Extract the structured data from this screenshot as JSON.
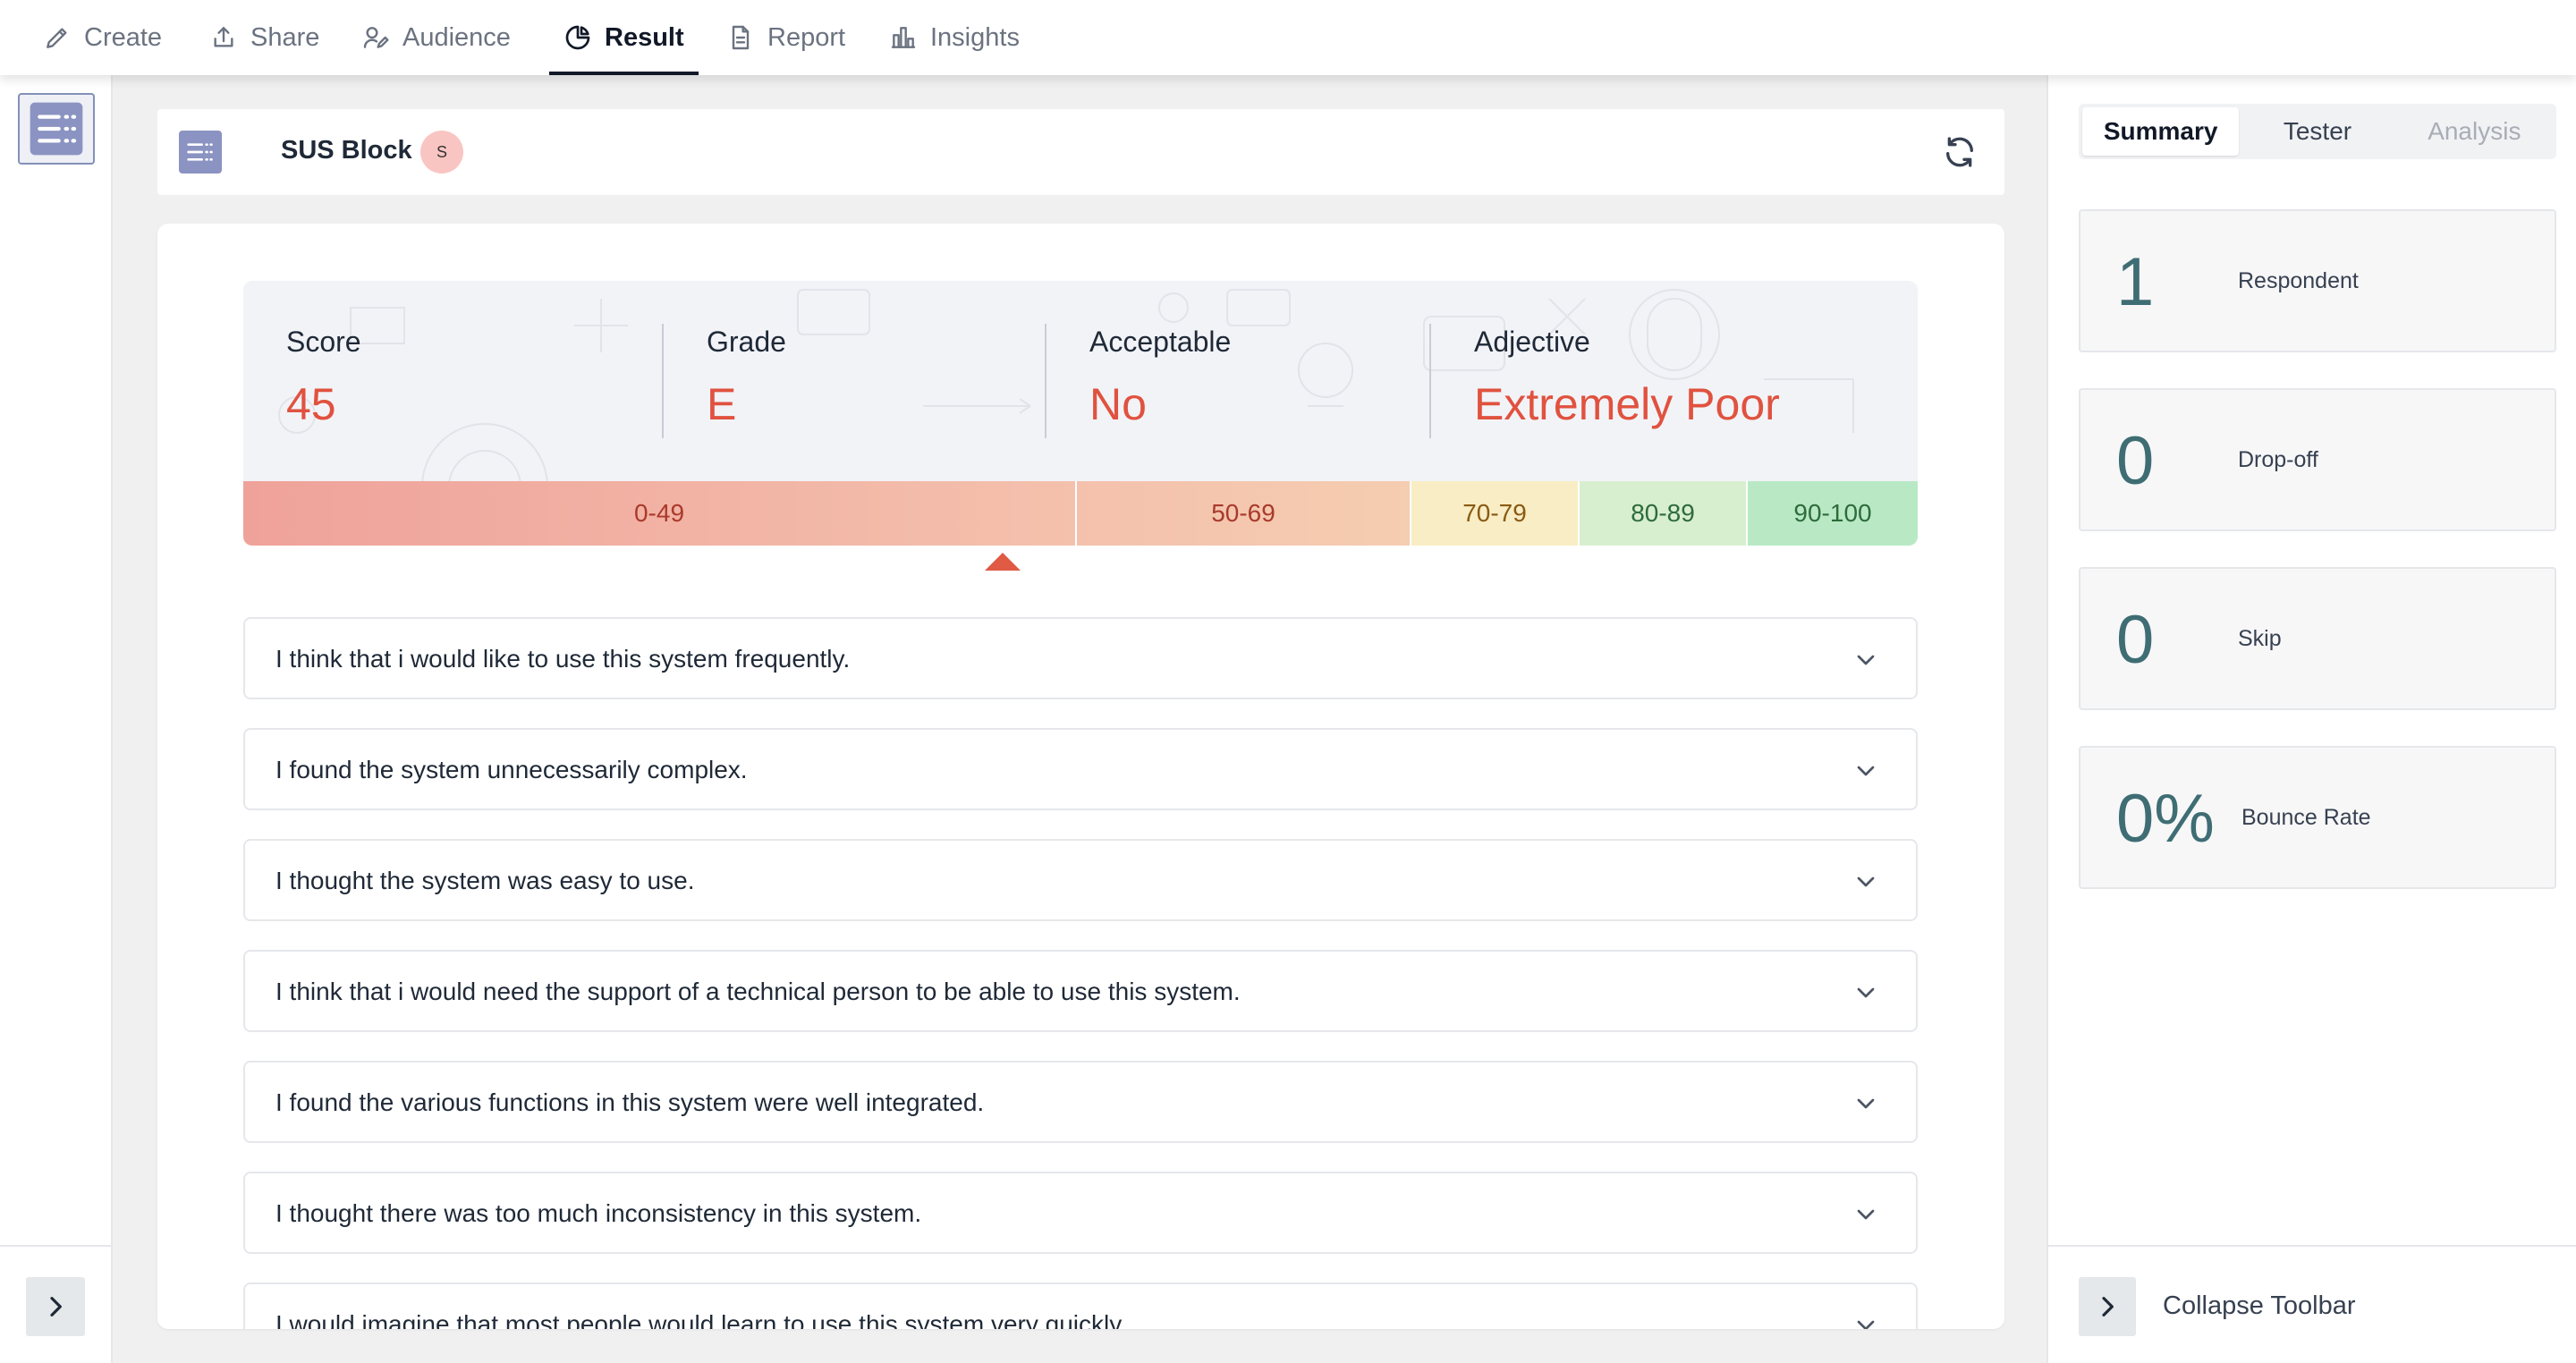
{
  "nav": {
    "items": [
      {
        "label": "Create",
        "icon": "pencil-icon"
      },
      {
        "label": "Share",
        "icon": "share-upload-icon"
      },
      {
        "label": "Audience",
        "icon": "audience-icon"
      },
      {
        "label": "Result",
        "icon": "pie-chart-icon",
        "active": true
      },
      {
        "label": "Report",
        "icon": "document-icon"
      },
      {
        "label": "Insights",
        "icon": "bar-chart-icon"
      }
    ]
  },
  "block": {
    "title": "SUS Block",
    "badge": "S"
  },
  "score": {
    "metrics": [
      {
        "label": "Score",
        "value": "45"
      },
      {
        "label": "Grade",
        "value": "E"
      },
      {
        "label": "Acceptable",
        "value": "No"
      },
      {
        "label": "Adjective",
        "value": "Extremely Poor"
      }
    ],
    "ranges": [
      {
        "label": "0-49"
      },
      {
        "label": "50-69"
      },
      {
        "label": "70-79"
      },
      {
        "label": "80-89"
      },
      {
        "label": "90-100"
      }
    ],
    "indicator_value": 45,
    "colors": {
      "value": "#e0523f",
      "indicator": "#e05a44"
    }
  },
  "questions": [
    "I think that i would like to use this system frequently.",
    "I found the system unnecessarily complex.",
    "I thought the system was easy to use.",
    "I think that i would need the support of a technical person to be able to use this system.",
    "I found the various functions in this system were well integrated.",
    "I thought there was too much inconsistency in this system.",
    "I would imagine that most people would learn to use this system very quickly."
  ],
  "right_panel": {
    "tabs": [
      {
        "label": "Summary",
        "state": "active"
      },
      {
        "label": "Tester",
        "state": "normal"
      },
      {
        "label": "Analysis",
        "state": "disabled"
      }
    ],
    "stats": [
      {
        "value": "1",
        "label": "Respondent"
      },
      {
        "value": "0",
        "label": "Drop-off"
      },
      {
        "value": "0",
        "label": "Skip"
      },
      {
        "value": "0%",
        "label": "Bounce Rate"
      }
    ],
    "collapse_label": "Collapse Toolbar"
  }
}
